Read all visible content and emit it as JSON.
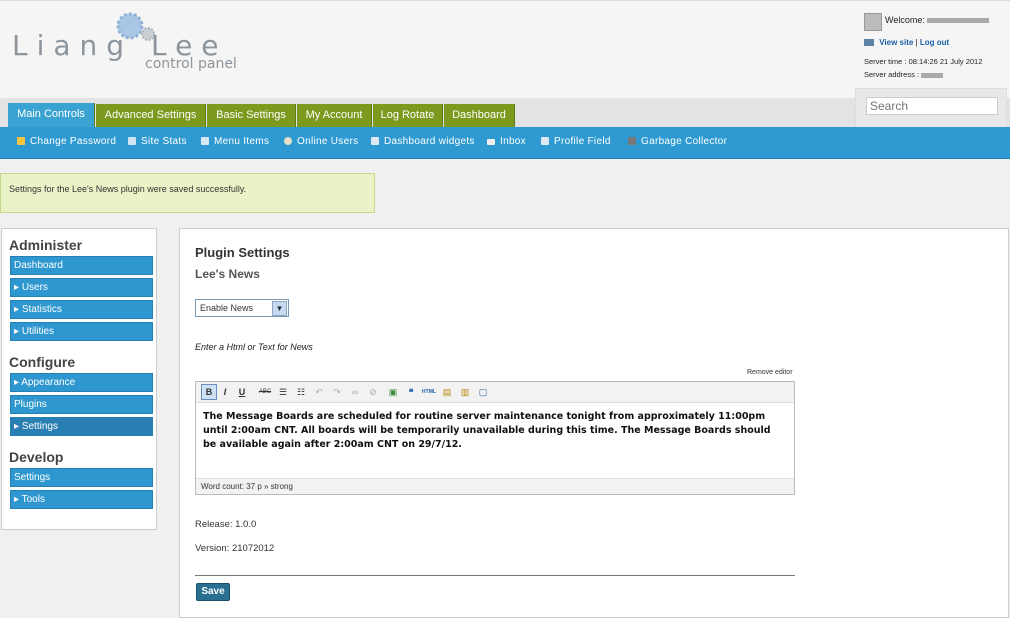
{
  "brand": {
    "name": "Liang Lee",
    "tagline": "control panel"
  },
  "user": {
    "welcome": "Welcome:",
    "view_site": "View site",
    "separator": "|",
    "logout": "Log out",
    "server_time": "Server time : 08:14:26 21 July 2012",
    "server_address": "Server address :"
  },
  "search": {
    "placeholder": "Search"
  },
  "tabs": [
    {
      "label": "Main Controls"
    },
    {
      "label": "Advanced Settings"
    },
    {
      "label": "Basic Settings"
    },
    {
      "label": "My Account"
    },
    {
      "label": "Log Rotate"
    },
    {
      "label": "Dashboard"
    }
  ],
  "subnav": [
    {
      "label": "Change Password",
      "icon": "lock-icon",
      "color": "#f4c542"
    },
    {
      "label": "Site Stats",
      "icon": "chat-icon",
      "color": "#cfe3f2"
    },
    {
      "label": "Menu Items",
      "icon": "menu-icon",
      "color": "#d9e6f2"
    },
    {
      "label": "Online Users",
      "icon": "user-icon",
      "color": "#e8e0c8"
    },
    {
      "label": "Dashboard widgets",
      "icon": "widget-icon",
      "color": "#dde8f0"
    },
    {
      "label": "Inbox",
      "icon": "mail-icon",
      "color": "#eeeeee"
    },
    {
      "label": "Profile Field",
      "icon": "form-icon",
      "color": "#dfe9f3"
    },
    {
      "label": "Garbage Collector",
      "icon": "trash-icon",
      "color": "#777777"
    }
  ],
  "notice": "Settings for the Lee's News plugin were saved successfully.",
  "sidebar": {
    "administer": {
      "heading": "Administer",
      "items": [
        "Dashboard",
        "Users",
        "Statistics",
        "Utilities"
      ]
    },
    "configure": {
      "heading": "Configure",
      "items": [
        "Appearance",
        "Plugins",
        "Settings"
      ]
    },
    "develop": {
      "heading": "Develop",
      "items": [
        "Settings",
        "Tools"
      ]
    }
  },
  "main": {
    "title": "Plugin Settings",
    "subtitle": "Lee's News",
    "select_value": "Enable News",
    "editor_label": "Enter a Html or Text for News",
    "remove_editor": "Remove editor",
    "content": "The Message Boards are scheduled for routine server maintenance tonight from approximately 11:00pm until 2:00am CNT. All boards will be temporarily unavailable during this time. The Message Boards should be available again after 2:00am CNT on 29/7/12.",
    "status": "Word count: 37 p » strong",
    "release": "Release: 1.0.0",
    "version": "Version: 21072012",
    "save": "Save"
  },
  "colors": {
    "accent": "#2e9ad1",
    "tab": "#7c9a1d",
    "notice_bg": "#eaf3c7",
    "save": "#2a6f92"
  }
}
